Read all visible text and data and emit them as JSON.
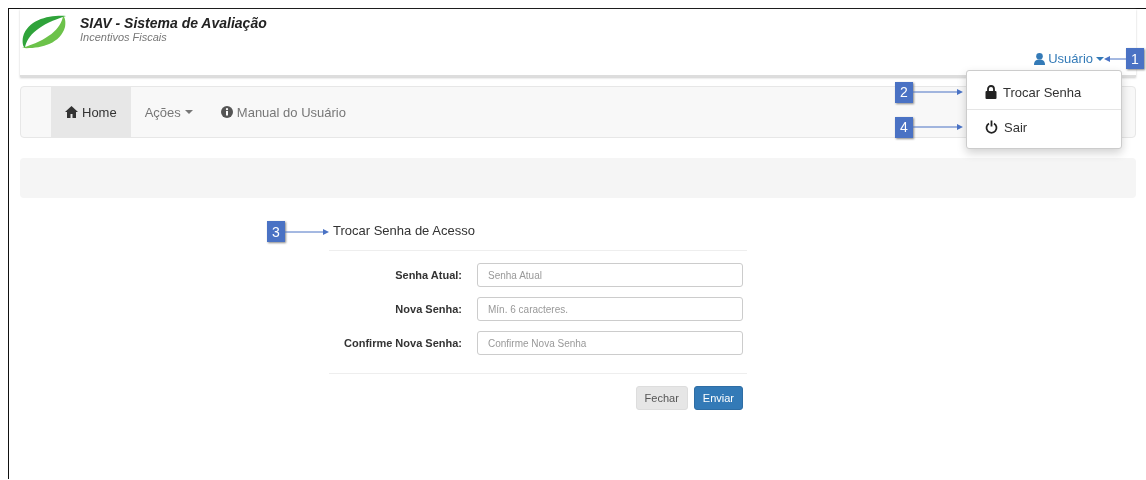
{
  "header": {
    "title": "SIAV - Sistema de Avaliação",
    "subtitle": "Incentivos Fiscais"
  },
  "user_menu": {
    "label": "Usuário",
    "callout": "1",
    "expanded": true,
    "items": [
      {
        "kind": "lock",
        "label": "Trocar Senha",
        "callout": "2"
      },
      {
        "kind": "power",
        "label": "Sair",
        "callout": "4"
      }
    ]
  },
  "nav": [
    {
      "kind": "home",
      "label": "Home",
      "selected": true
    },
    {
      "kind": "dropdown",
      "label": "Ações",
      "selected": false
    },
    {
      "kind": "info",
      "label": "Manual do Usuário",
      "selected": false
    }
  ],
  "form": {
    "title": "Trocar Senha de Acesso",
    "callout": "3",
    "fields": [
      {
        "label": "Senha Atual:",
        "placeholder": "Senha Atual"
      },
      {
        "label": "Nova Senha:",
        "placeholder": "Mín. 6 caracteres."
      },
      {
        "label": "Confirme Nova Senha:",
        "placeholder": "Confirme Nova Senha"
      }
    ],
    "buttons": [
      {
        "kind": "default",
        "label": "Fechar"
      },
      {
        "kind": "primary",
        "label": "Enviar"
      }
    ]
  }
}
